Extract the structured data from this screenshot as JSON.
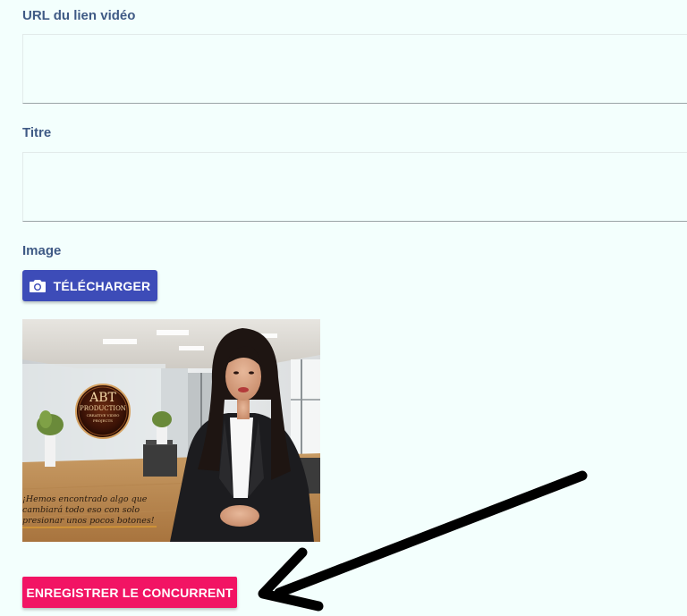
{
  "form": {
    "video_url_label": "URL du lien vidéo",
    "video_url_value": "",
    "title_label": "Titre",
    "title_value": "",
    "image_label": "Image",
    "upload_button_label": "TÉLÉCHARGER",
    "upload_button_icon": "camera-icon",
    "preview_image": {
      "logo_text": "ABT",
      "logo_subtext": "PRODUCTION",
      "logo_tiny_text": "CREATIVE VIDEO PROJECTS",
      "caption_lines": [
        "¡Hemos encontrado algo que",
        "cambiará todo eso con solo",
        "presionar unos pocos botones!"
      ]
    },
    "submit_button_label": "ENREGISTRER LE CONCURRENT"
  },
  "colors": {
    "background": "#f3fffd",
    "label": "#3f5a85",
    "upload_button": "#3d4cb8",
    "submit_button": "#f21464",
    "annotation_arrow": "#000000"
  }
}
